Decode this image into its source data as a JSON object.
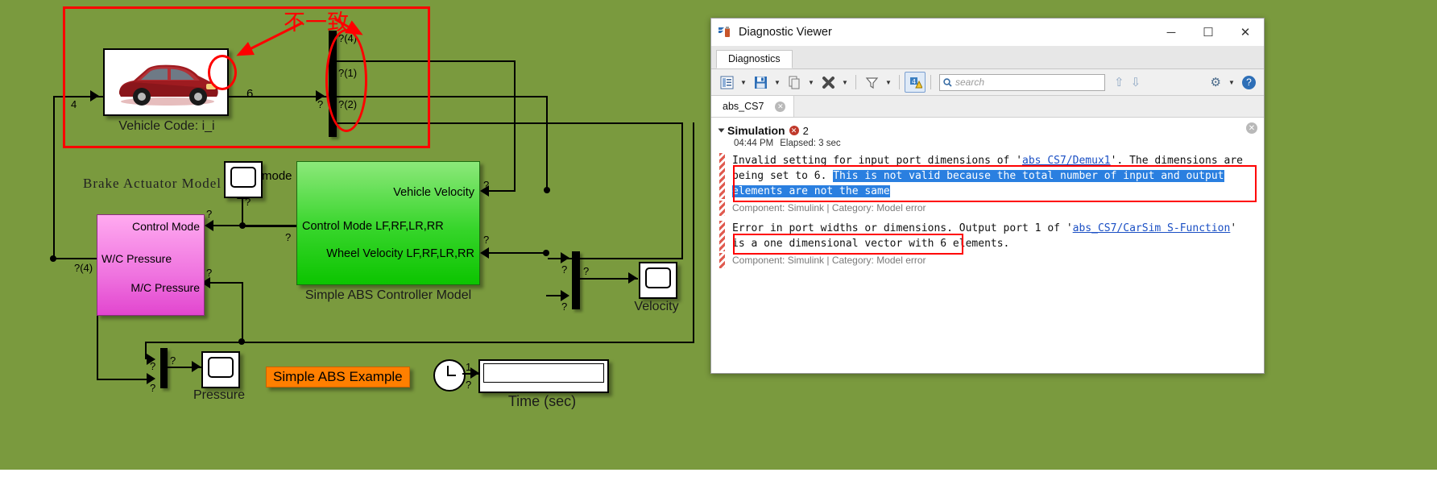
{
  "model": {
    "vehicle_block": {
      "label": "Vehicle Code: i_i",
      "in_port_signal": "4",
      "out_port_signal": "6"
    },
    "demux_signals": [
      "?(4)",
      "?(1)",
      "?(2)"
    ],
    "demux_in_signal": "?",
    "controller_block": {
      "label": "Simple ABS Controller Model",
      "ports": [
        "Vehicle Velocity",
        "Control Mode LF,RF,LR,RR",
        "Wheel Velocity LF,RF,LR,RR"
      ],
      "port_signals": [
        "?",
        "?",
        "?"
      ]
    },
    "brake_block": {
      "title": "Brake Actuator Model",
      "ports": [
        "Control Mode",
        "W/C Pressure",
        "M/C Pressure"
      ],
      "in_signal": "?(4)",
      "port_signals": [
        "?",
        "?"
      ]
    },
    "mode_scope": {
      "label": "mode",
      "signal": "?"
    },
    "pressure_scope": {
      "label": "Pressure",
      "signal": "?"
    },
    "velocity_scope": {
      "label": "Velocity",
      "signal": "?"
    },
    "time_display": {
      "label": "Time (sec)",
      "clock_signal": "1",
      "in_signal": "?",
      "value": ""
    },
    "mux_signals": [
      "?",
      "?",
      "?"
    ],
    "annotation_orange": "Simple ABS Example",
    "annotation_red_note": "不一致",
    "colors": {
      "canvas": "#7a9a3e",
      "controller": "#2ad41e",
      "brake": "#ef73df",
      "annotation": "#ff7f00",
      "highlight_red": "#ff0000"
    }
  },
  "diagnostic_viewer": {
    "title": "Diagnostic Viewer",
    "window_buttons": {
      "minimize": "─",
      "maximize": "☐",
      "close": "✕"
    },
    "tab": "Diagnostics",
    "toolbar": {
      "buttons": [
        "view-settings",
        "save",
        "copy",
        "clear",
        "filter",
        "warnings-errors"
      ],
      "search_placeholder": "search",
      "search_value": "",
      "nav_up": "⇧",
      "nav_down": "⇩",
      "settings": "⚙",
      "help": "?"
    },
    "subtab": {
      "label": "abs_CS7",
      "close": "✕"
    },
    "group": {
      "title": "Simulation",
      "error_count": "2",
      "time": "04:44 PM",
      "elapsed": "Elapsed: 3 sec"
    },
    "messages": [
      {
        "segments": [
          {
            "text": "Invalid setting for input port dimensions of '",
            "style": "plain"
          },
          {
            "text": "abs_CS7/Demux1",
            "style": "link"
          },
          {
            "text": "'. The dimensions are being set to 6. ",
            "style": "plain"
          },
          {
            "text": "This is not valid because the total number of input and output elements are not the same",
            "style": "highlight"
          }
        ],
        "component": "Component:  Simulink | Category:  Model error"
      },
      {
        "segments": [
          {
            "text": "Error in port widths or dimensions.",
            "style": "boxed"
          },
          {
            "text": " Output port 1 of '",
            "style": "plain"
          },
          {
            "text": "abs_CS7/CarSim S-Function",
            "style": "link"
          },
          {
            "text": "' is a one dimensional vector with 6 elements.",
            "style": "plain"
          }
        ],
        "component": "Component:  Simulink | Category:  Model error"
      }
    ]
  }
}
